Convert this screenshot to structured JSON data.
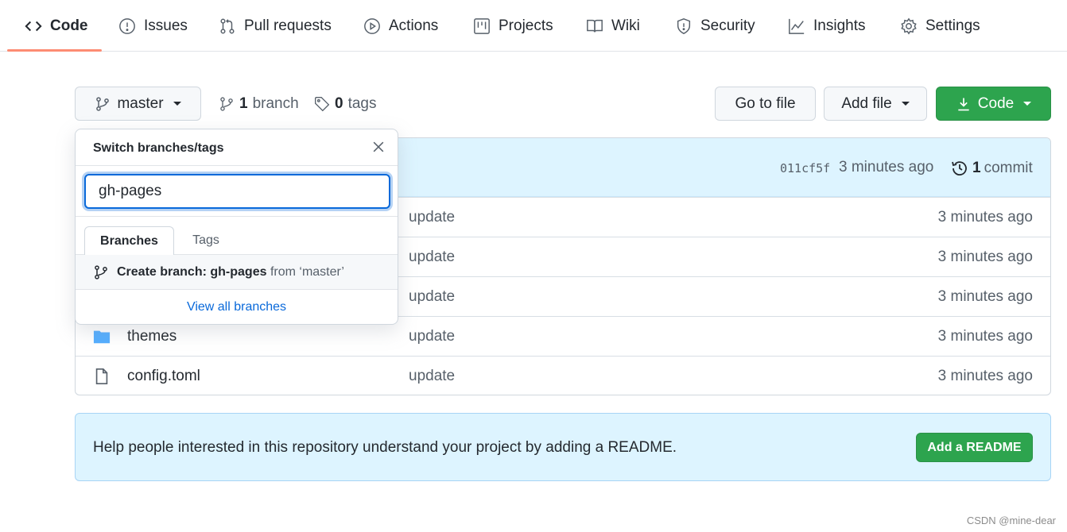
{
  "nav": {
    "tabs": [
      {
        "label": "Code",
        "icon": "code-icon"
      },
      {
        "label": "Issues",
        "icon": "issue-icon"
      },
      {
        "label": "Pull requests",
        "icon": "pull-request-icon"
      },
      {
        "label": "Actions",
        "icon": "play-icon"
      },
      {
        "label": "Projects",
        "icon": "project-icon"
      },
      {
        "label": "Wiki",
        "icon": "book-icon"
      },
      {
        "label": "Security",
        "icon": "shield-icon"
      },
      {
        "label": "Insights",
        "icon": "graph-icon"
      },
      {
        "label": "Settings",
        "icon": "gear-icon"
      }
    ],
    "active_tab": "Code"
  },
  "toolbar": {
    "branch_button": "master",
    "branch_count": "1",
    "branch_word": "branch",
    "tag_count": "0",
    "tag_word": "tags",
    "go_to_file": "Go to file",
    "add_file": "Add file",
    "code": "Code"
  },
  "latest_commit": {
    "hash": "011cf5f",
    "time": "3 minutes ago",
    "count": "1",
    "count_word": "commit"
  },
  "files": [
    {
      "name": "",
      "message": "update",
      "age": "3 minutes ago",
      "type": "folder"
    },
    {
      "name": "",
      "message": "update",
      "age": "3 minutes ago",
      "type": "folder"
    },
    {
      "name": "",
      "message": "update",
      "age": "3 minutes ago",
      "type": "folder"
    },
    {
      "name": "themes",
      "message": "update",
      "age": "3 minutes ago",
      "type": "folder"
    },
    {
      "name": "config.toml",
      "message": "update",
      "age": "3 minutes ago",
      "type": "file"
    }
  ],
  "readme_banner": {
    "text": "Help people interested in this repository understand your project by adding a README.",
    "button": "Add a README"
  },
  "branch_dropdown": {
    "title": "Switch branches/tags",
    "input_value": "gh-pages",
    "tabs": [
      "Branches",
      "Tags"
    ],
    "active_tab": "Branches",
    "create_prefix": "Create branch: gh-pages",
    "create_suffix": "from ‘master’",
    "view_all": "View all branches"
  },
  "watermark": "CSDN @mine-dear",
  "colors": {
    "accent_blue": "#0969da",
    "green": "#2da44e",
    "folder_blue": "#54aeff",
    "tab_underline": "#fd8c73",
    "banner_bg": "#ddf4ff"
  }
}
